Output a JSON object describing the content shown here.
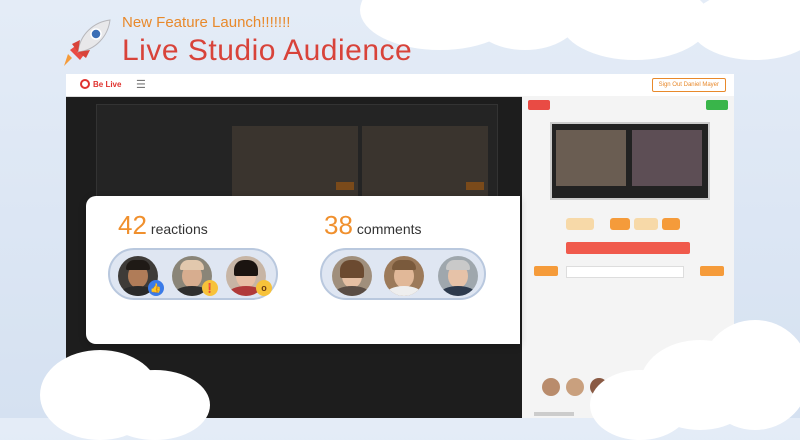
{
  "promo": {
    "kicker": "New Feature Launch!!!!!!!",
    "headline": "Live Studio Audience"
  },
  "app": {
    "logo_text": "Be Live",
    "signout_label": "Sign Out Daniel Mayer"
  },
  "overlay": {
    "reactions": {
      "count": "42",
      "label": "reactions"
    },
    "comments": {
      "count": "38",
      "label": "comments"
    }
  },
  "colors": {
    "accent_orange": "#f0902e",
    "headline_red": "#d8433a",
    "reaction_like": "#3b7be8",
    "reaction_haha": "#f7c23a"
  },
  "icons": {
    "rocket": "rocket-icon",
    "menu": "hamburger-menu-icon",
    "like": "thumbs-up-reaction-icon",
    "haha": "laughing-reaction-icon",
    "wow": "wow-reaction-icon"
  }
}
